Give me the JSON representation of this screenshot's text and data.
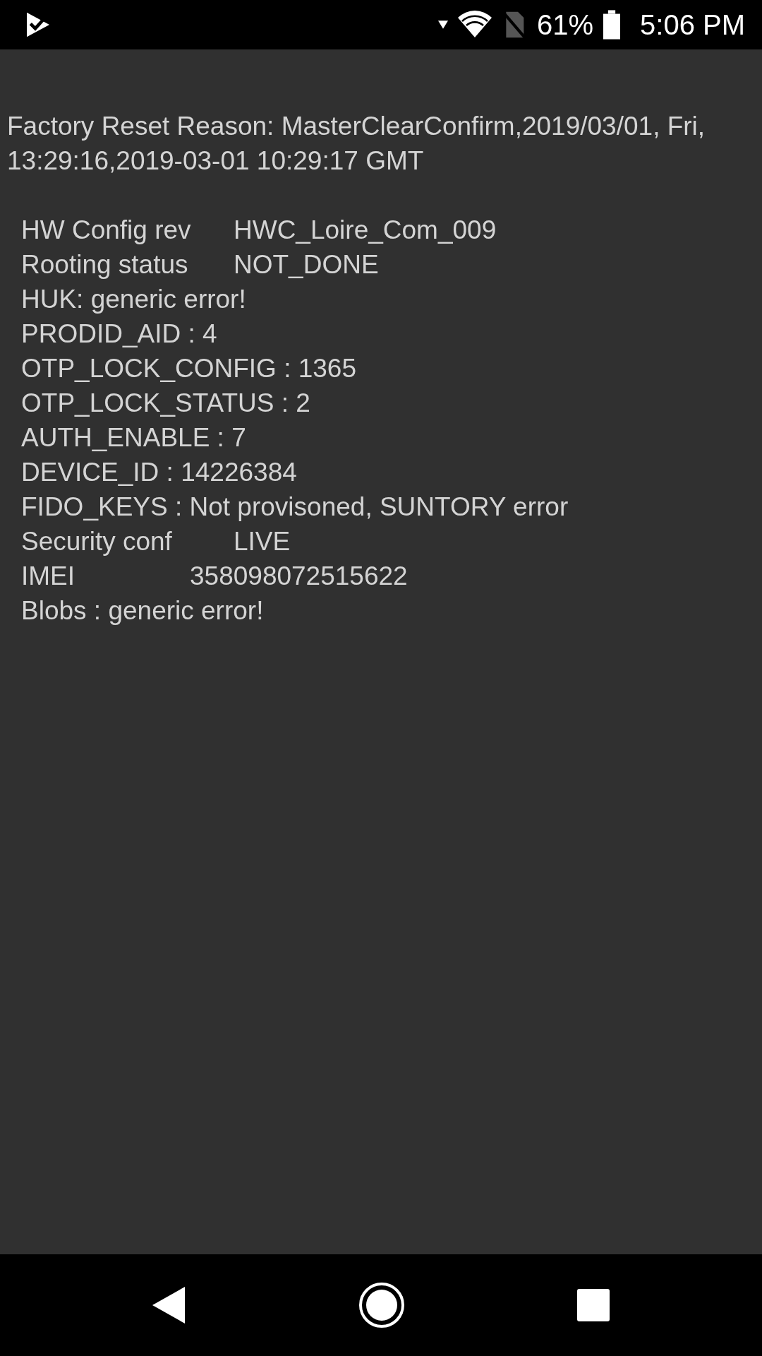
{
  "status_bar": {
    "battery_text": "61%",
    "time": "5:06 PM"
  },
  "header": "Factory Reset Reason: MasterClearConfirm,2019/03/01, Fri, 13:29:16,2019-03-01 10:29:17 GMT",
  "rows": [
    {
      "kind": "pair",
      "label": "HW Config rev",
      "value": "HWC_Loire_Com_009"
    },
    {
      "kind": "pair",
      "label": "Rooting status",
      "value": "NOT_DONE"
    },
    {
      "kind": "line",
      "text": "HUK: generic error!"
    },
    {
      "kind": "line",
      "text": "PRODID_AID : 4"
    },
    {
      "kind": "line",
      "text": "OTP_LOCK_CONFIG : 1365"
    },
    {
      "kind": "line",
      "text": "OTP_LOCK_STATUS : 2"
    },
    {
      "kind": "line",
      "text": "AUTH_ENABLE : 7"
    },
    {
      "kind": "line",
      "text": "DEVICE_ID : 14226384"
    },
    {
      "kind": "line",
      "text": "FIDO_KEYS : Not provisoned, SUNTORY error"
    },
    {
      "kind": "pair",
      "label": "Security conf",
      "value": "LIVE"
    },
    {
      "kind": "pair_narrow",
      "label": "IMEI",
      "value": "358098072515622"
    },
    {
      "kind": "line",
      "text": "Blobs : generic error!"
    }
  ]
}
